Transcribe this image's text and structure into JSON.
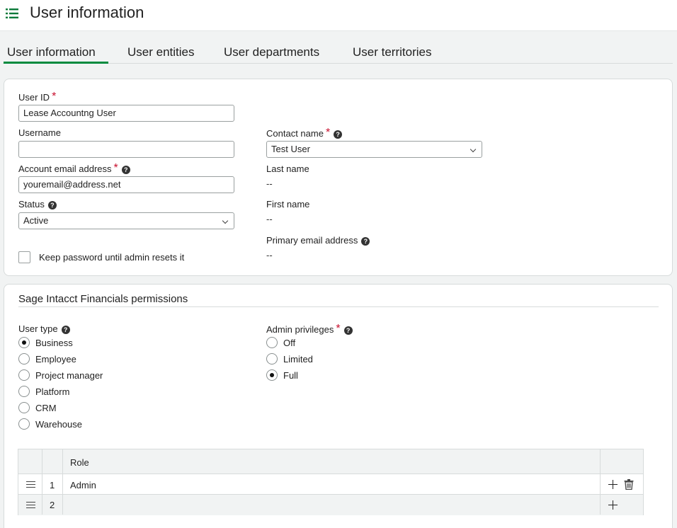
{
  "header": {
    "title": "User information",
    "menu_icon": "list-icon"
  },
  "tabs": [
    {
      "label": "User information",
      "active": true
    },
    {
      "label": "User entities",
      "active": false
    },
    {
      "label": "User departments",
      "active": false
    },
    {
      "label": "User territories",
      "active": false
    }
  ],
  "user_form": {
    "user_id": {
      "label": "User ID",
      "value": "Lease Accountng User",
      "required": true
    },
    "username": {
      "label": "Username",
      "value": ""
    },
    "account_email": {
      "label": "Account email address",
      "value": "youremail@address.net",
      "required": true
    },
    "status": {
      "label": "Status",
      "value": "Active"
    },
    "keep_password": {
      "label": "Keep password until admin resets it",
      "checked": false
    },
    "contact_name": {
      "label": "Contact name",
      "value": "Test User",
      "required": true
    },
    "last_name": {
      "label": "Last name",
      "value": "--"
    },
    "first_name": {
      "label": "First name",
      "value": "--"
    },
    "primary_email": {
      "label": "Primary email address",
      "value": "--"
    }
  },
  "permissions": {
    "title": "Sage Intacct Financials permissions",
    "user_type": {
      "label": "User type",
      "options": [
        "Business",
        "Employee",
        "Project manager",
        "Platform",
        "CRM",
        "Warehouse"
      ],
      "selected": "Business"
    },
    "admin_privileges": {
      "label": "Admin privileges",
      "required": true,
      "options": [
        "Off",
        "Limited",
        "Full"
      ],
      "selected": "Full"
    }
  },
  "roles_grid": {
    "header": "Role",
    "rows": [
      {
        "num": "1",
        "role": "Admin"
      },
      {
        "num": "2",
        "role": ""
      }
    ]
  },
  "colors": {
    "accent": "#008a3e",
    "required": "#c8102e",
    "background": "#f1f3f3"
  }
}
